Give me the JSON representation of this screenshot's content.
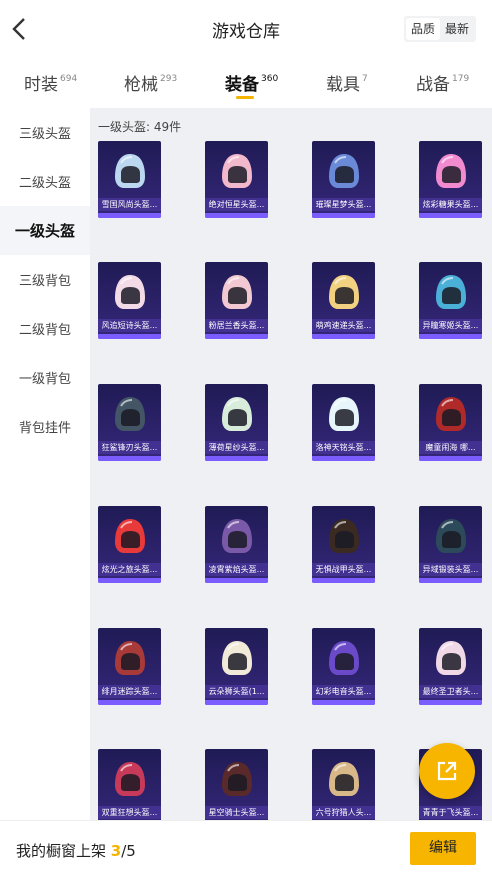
{
  "header": {
    "title": "游戏仓库",
    "sort_options": [
      "品质",
      "最新"
    ]
  },
  "tabs": [
    {
      "label": "时装",
      "count": "694"
    },
    {
      "label": "枪械",
      "count": "293"
    },
    {
      "label": "装备",
      "count": "360"
    },
    {
      "label": "载具",
      "count": "7"
    },
    {
      "label": "战备",
      "count": "179"
    }
  ],
  "active_tab": "装备",
  "sidebar": [
    "三级头盔",
    "二级头盔",
    "一级头盔",
    "三级背包",
    "二级背包",
    "一级背包",
    "背包挂件"
  ],
  "active_sidebar": "一级头盔",
  "category_count": "一级头盔: 49件",
  "items": [
    {
      "name": "雪国风尚头盔...",
      "color": "#bcd8f0"
    },
    {
      "name": "绝对恒星头盔...",
      "color": "#f2b8cc"
    },
    {
      "name": "璀璨星梦头盔...",
      "color": "#6a8ad8"
    },
    {
      "name": "炫彩糖果头盔...",
      "color": "#f28ad0"
    },
    {
      "name": "风追短诗头盔...",
      "color": "#f2dbe6"
    },
    {
      "name": "粉居兰香头盔...",
      "color": "#f2c8d2"
    },
    {
      "name": "萌鸡速递头盔...",
      "color": "#f2d280"
    },
    {
      "name": "异瞳寒姬头盔...",
      "color": "#4ab0d8"
    },
    {
      "name": "狂鲨锋刃头盔...",
      "color": "#445566"
    },
    {
      "name": "薄荷星纱头盔...",
      "color": "#d8ecdc"
    },
    {
      "name": "洛神天铭头盔...",
      "color": "#e6f6fa"
    },
    {
      "name": "魔童闹海 哪...",
      "color": "#b02a2a"
    },
    {
      "name": "炫光之旅头盔...",
      "color": "#e83a3a"
    },
    {
      "name": "凌霄紫焰头盔...",
      "color": "#7a5aa8"
    },
    {
      "name": "无惧战甲头盔...",
      "color": "#3a2a22"
    },
    {
      "name": "异域锻装头盔...",
      "color": "#2c4a5a"
    },
    {
      "name": "绯月迷踪头盔...",
      "color": "#a83a3a"
    },
    {
      "name": "云朵狮头盔(1...",
      "color": "#f2ead8"
    },
    {
      "name": "幻彩电音头盔...",
      "color": "#6a4ac8"
    },
    {
      "name": "最终圣卫者头...",
      "color": "#f0d8e6"
    },
    {
      "name": "双重狂想头盔...",
      "color": "#c83a5a"
    },
    {
      "name": "星空骑士头盔...",
      "color": "#5a2a2a"
    },
    {
      "name": "六号狩猎人头...",
      "color": "#d8b888"
    },
    {
      "name": "青青于飞头盔...",
      "color": "#e85aa8"
    }
  ],
  "bottom": {
    "prefix": "我的橱窗上架 ",
    "current": "3",
    "sep_total": "/5",
    "edit_label": "编辑"
  },
  "colors": {
    "accent": "#f7b500",
    "card_bg": "#2a2166",
    "card_bar": "#7b5cff"
  }
}
